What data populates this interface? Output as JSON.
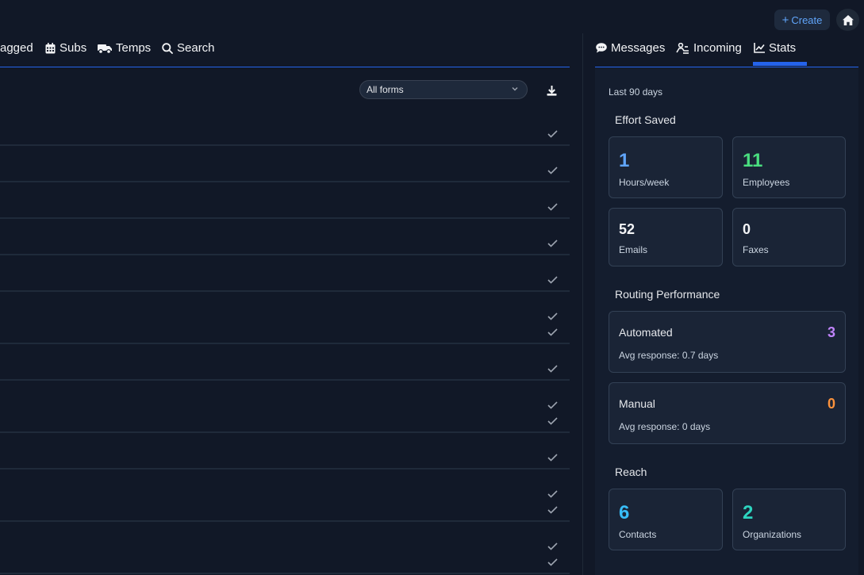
{
  "topbar": {
    "create_label": "Create"
  },
  "left_tabs": [
    {
      "label": "agged",
      "icon": "tag-icon"
    },
    {
      "label": "Subs",
      "icon": "calendar-icon"
    },
    {
      "label": "Temps",
      "icon": "truck-icon"
    },
    {
      "label": "Search",
      "icon": "search-icon"
    }
  ],
  "toolbar": {
    "form_filter": "All forms"
  },
  "right_tabs": [
    {
      "label": "Messages",
      "icon": "chat-icon"
    },
    {
      "label": "Incoming",
      "icon": "incoming-icon"
    },
    {
      "label": "Stats",
      "icon": "chart-line-icon",
      "active": true
    }
  ],
  "stats": {
    "period": "Last 90 days",
    "effort_title": "Effort Saved",
    "effort": [
      {
        "value": "1",
        "label": "Hours/week",
        "color": "#60a5fa"
      },
      {
        "value": "11",
        "label": "Employees",
        "color": "#4ade80"
      },
      {
        "value": "52",
        "label": "Emails",
        "color": "#f3f4f6"
      },
      {
        "value": "0",
        "label": "Faxes",
        "color": "#f3f4f6"
      }
    ],
    "routing_title": "Routing Performance",
    "routing": [
      {
        "name": "Automated",
        "value": "3",
        "sub": "Avg response: 0.7 days",
        "color": "#c084fc"
      },
      {
        "name": "Manual",
        "value": "0",
        "sub": "Avg response: 0 days",
        "color": "#fb923c"
      }
    ],
    "reach_title": "Reach",
    "reach": [
      {
        "value": "6",
        "label": "Contacts",
        "color": "#38bdf8"
      },
      {
        "value": "2",
        "label": "Organizations",
        "color": "#2dd4bf"
      }
    ]
  },
  "colors": {
    "accent": "#2563eb",
    "background": "#111827"
  }
}
